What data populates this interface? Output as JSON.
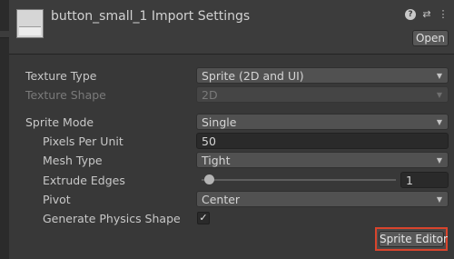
{
  "header": {
    "title": "button_small_1 Import Settings",
    "open_label": "Open",
    "icons": [
      "help-icon",
      "preset-sliders-icon",
      "more-vertical-icon"
    ]
  },
  "texture_type": {
    "label": "Texture Type",
    "value": "Sprite (2D and UI)"
  },
  "texture_shape": {
    "label": "Texture Shape",
    "value": "2D"
  },
  "sprite_mode": {
    "label": "Sprite Mode",
    "value": "Single"
  },
  "pixels_per_unit": {
    "label": "Pixels Per Unit",
    "value": "50"
  },
  "mesh_type": {
    "label": "Mesh Type",
    "value": "Tight"
  },
  "extrude_edges": {
    "label": "Extrude Edges",
    "value": "1",
    "slider_fraction": 0.03
  },
  "pivot": {
    "label": "Pivot",
    "value": "Center"
  },
  "generate_physics_shape": {
    "label": "Generate Physics Shape",
    "checked": true,
    "check_glyph": "✓"
  },
  "sprite_editor": {
    "label": "Sprite Editor"
  },
  "colors": {
    "background": "#383838",
    "highlight": "#d9442c"
  }
}
